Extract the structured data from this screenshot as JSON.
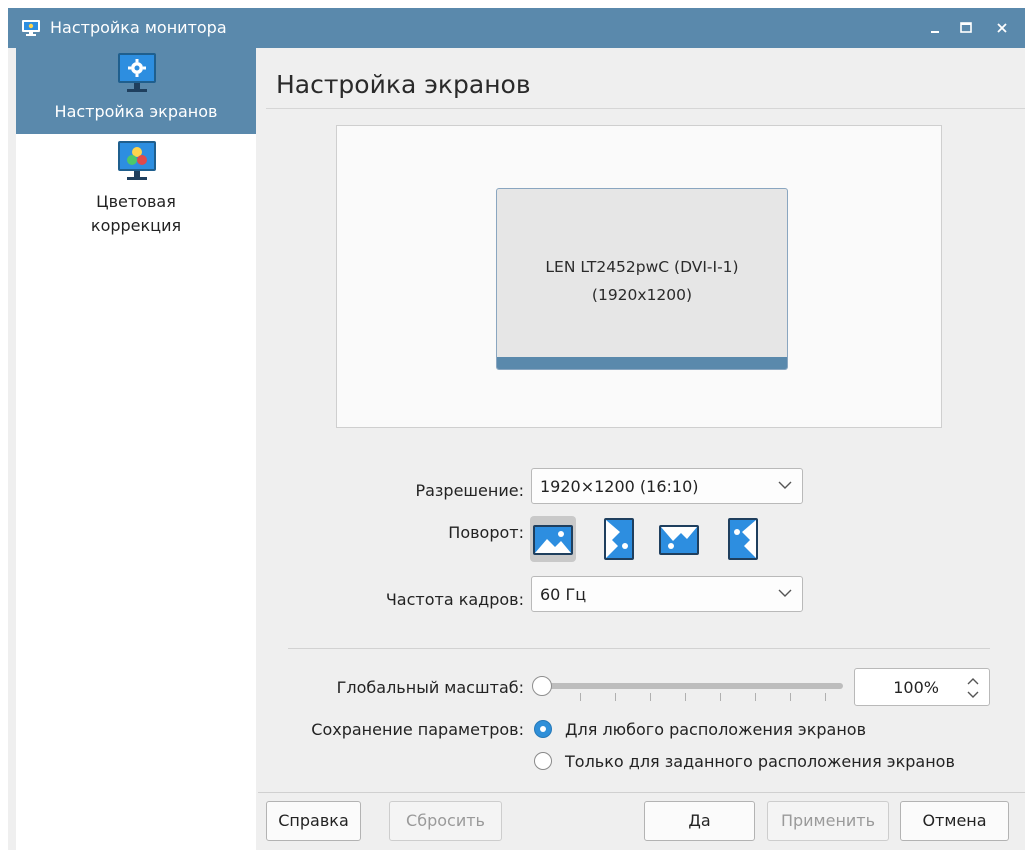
{
  "window": {
    "title": "Настройка монитора",
    "buttons": [
      "minimize-icon",
      "maximize-icon",
      "close-icon"
    ]
  },
  "sidebar": {
    "items": [
      {
        "label": "Настройка экранов",
        "icon": "monitor-settings-icon",
        "active": true
      },
      {
        "label_line1": "Цветовая",
        "label_line2": "коррекция",
        "icon": "color-correction-icon",
        "active": false
      }
    ]
  },
  "main": {
    "title": "Настройка экранов",
    "preview": {
      "monitor_name": "LEN LT2452pwC (DVI-I-1)",
      "monitor_resolution": "(1920x1200)"
    },
    "resolution": {
      "label": "Разрешение:",
      "value": "1920×1200 (16:10)"
    },
    "rotation": {
      "label": "Поворот:",
      "options": [
        "rotate-normal-icon",
        "rotate-left-icon",
        "rotate-inverted-icon",
        "rotate-right-icon"
      ],
      "selected": 0
    },
    "refresh": {
      "label": "Частота кадров:",
      "value": "60 Гц"
    },
    "scale": {
      "label": "Глобальный масштаб:",
      "value": "100%",
      "slider_level": 0
    },
    "save": {
      "label": "Сохранение параметров:",
      "options": [
        "Для любого расположения экранов",
        "Только для заданного расположения экранов"
      ],
      "selected": 0
    }
  },
  "footer": {
    "help": "Справка",
    "reset": "Сбросить",
    "ok": "Да",
    "apply": "Применить",
    "cancel": "Отмена"
  },
  "colors": {
    "accent": "#5a89ac",
    "icon_blue": "#2d8ee0",
    "radio_blue": "#2f8fd8"
  }
}
